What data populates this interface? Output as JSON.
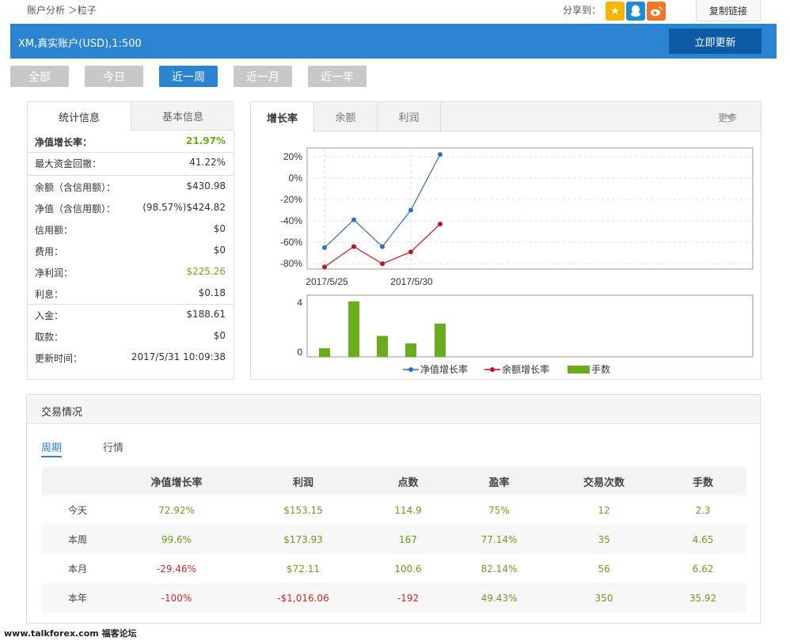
{
  "breadcrumb": "账户分析 ＞粒子",
  "share": {
    "label": "分享到：",
    "icons": [
      "star-icon",
      "qq-icon",
      "weibo-icon"
    ],
    "copy_label": "复制链接"
  },
  "account": {
    "title": "XM,真实账户(USD),1:500",
    "refresh_label": "立即更新",
    "bar_color": "#2a84d1"
  },
  "periods": [
    "全部",
    "今日",
    "近一周",
    "近一月",
    "近一年"
  ],
  "active_period": "近一周",
  "stats": {
    "tabs": [
      "统计信息",
      "基本信息"
    ],
    "rows": [
      {
        "label": "净值增长率：",
        "value": "21.97%"
      },
      {
        "label": "最大资金回撤：",
        "value": "41.22%"
      },
      {
        "label": "余额（含信用额）：",
        "value": "$430.98"
      },
      {
        "label": "净值（含信用额）：",
        "value": "(98.57%)$424.82"
      },
      {
        "label": "信用额：",
        "value": "$0"
      },
      {
        "label": "费用：",
        "value": "$0"
      },
      {
        "label": "净利润：",
        "value": "$225.26"
      },
      {
        "label": "利息：",
        "value": "$0.18"
      },
      {
        "label": "入金：",
        "value": "$188.61"
      },
      {
        "label": "取款：",
        "value": "$0"
      },
      {
        "label": "更新时间：",
        "value": "2017/5/31 10:09:38"
      }
    ]
  },
  "chart_tabs": [
    "增长率",
    "余额",
    "利润"
  ],
  "more_label": "更多",
  "chart_data": {
    "type": "line",
    "x": [
      "2017/5/25",
      "2017/5/26",
      "2017/5/29",
      "2017/5/30",
      "2017/5/31"
    ],
    "x_ticks": [
      "2017/5/25",
      "2017/5/30"
    ],
    "y_ticks": [
      "20%",
      "0%",
      "-20%",
      "-40%",
      "-60%",
      "-80%"
    ],
    "ylim": [
      -85,
      28
    ],
    "series": [
      {
        "name": "净值增长率",
        "color": "#2f6fbd",
        "values": [
          -65,
          -39,
          -64,
          -30,
          22
        ]
      },
      {
        "name": "余额增长率",
        "color": "#c1121f",
        "values": [
          -83,
          -64,
          -80,
          -69,
          -43
        ]
      }
    ],
    "volume": {
      "name": "手数",
      "color": "#6aad1c",
      "y_ticks": [
        "4",
        "0"
      ],
      "ylim": [
        -0.4,
        4.6
      ],
      "values": [
        0.3,
        4.1,
        1.3,
        0.7,
        2.3
      ]
    },
    "legend": [
      "净值增长率",
      "余额增长率",
      "手数"
    ]
  },
  "trade": {
    "title": "交易情况",
    "sub_tabs": [
      "周期",
      "行情"
    ],
    "columns": [
      "",
      "净值增长率",
      "利润",
      "点数",
      "盈率",
      "交易次数",
      "手数"
    ],
    "rows": [
      {
        "period": "今天",
        "growth": "72.92%",
        "profit": "$153.15",
        "points": "114.9",
        "win": "75%",
        "trades": "12",
        "lots": "2.3",
        "growth_neg": false,
        "profit_neg": false,
        "points_neg": false
      },
      {
        "period": "本周",
        "growth": "99.6%",
        "profit": "$173.93",
        "points": "167",
        "win": "77.14%",
        "trades": "35",
        "lots": "4.65",
        "growth_neg": false,
        "profit_neg": false,
        "points_neg": false
      },
      {
        "period": "本月",
        "growth": "-29.46%",
        "profit": "$72.11",
        "points": "100.6",
        "win": "82.14%",
        "trades": "56",
        "lots": "6.62",
        "growth_neg": true,
        "profit_neg": false,
        "points_neg": false
      },
      {
        "period": "本年",
        "growth": "-100%",
        "profit": "-$1,016.06",
        "points": "-192",
        "win": "49.43%",
        "trades": "350",
        "lots": "35.92",
        "growth_neg": true,
        "profit_neg": true,
        "points_neg": true
      }
    ]
  },
  "footer": {
    "site": "www.talkforex.com",
    "forum": "福客论坛"
  },
  "colors": {
    "positive": "#6a9e1d",
    "negative": "#d9252a",
    "accent": "#2a84d1"
  }
}
